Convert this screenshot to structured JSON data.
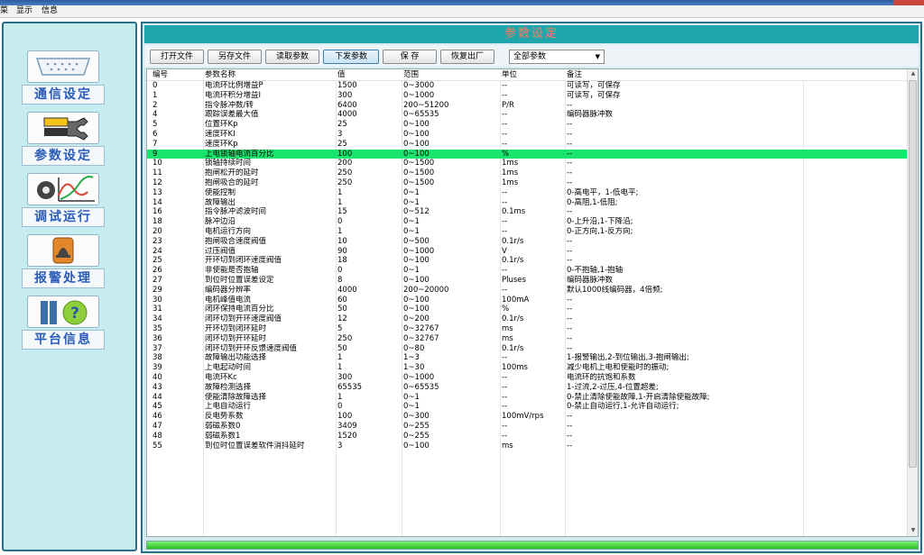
{
  "menubar": {
    "items": [
      "菜",
      "显示",
      "信息"
    ]
  },
  "sidebar": {
    "items": [
      {
        "label": "通信设定",
        "icon": "serial-port-icon"
      },
      {
        "label": "参数设定",
        "icon": "tools-icon"
      },
      {
        "label": "调试运行",
        "icon": "chart-curve-icon"
      },
      {
        "label": "报警处理",
        "icon": "alarm-bell-icon"
      },
      {
        "label": "平台信息",
        "icon": "help-icon"
      }
    ]
  },
  "main": {
    "title": "参数设定",
    "toolbar": {
      "open_file": "打开文件",
      "save_as": "另存文件",
      "read_params": "读取参数",
      "download_params": "下发参数",
      "save": "保 存",
      "restore_factory": "恢复出厂",
      "filter_selected": "全部参数"
    },
    "table": {
      "columns": [
        "编号",
        "参数名称",
        "值",
        "范围",
        "单位",
        "备注"
      ],
      "selected_index": 7,
      "rows": [
        [
          "0",
          "电流环比例增益P",
          "1500",
          "0~3000",
          "--",
          "可读写，可保存"
        ],
        [
          "1",
          "电流环积分增益I",
          "300",
          "0~1000",
          "--",
          "可读写，可保存"
        ],
        [
          "2",
          "指令脉冲数/转",
          "6400",
          "200~51200",
          "P/R",
          "--"
        ],
        [
          "4",
          "跟踪误差最大值",
          "4000",
          "0~65535",
          "--",
          "编码器脉冲数"
        ],
        [
          "5",
          "位置环Kp",
          "25",
          "0~100",
          "--",
          "--"
        ],
        [
          "6",
          "速度环KI",
          "3",
          "0~100",
          "--",
          "--"
        ],
        [
          "7",
          "速度环Kp",
          "25",
          "0~100",
          "--",
          "--"
        ],
        [
          "9",
          "上电锁轴电流百分比",
          "100",
          "0~100",
          "%",
          "--"
        ],
        [
          "10",
          "锁轴持续时间",
          "200",
          "0~1500",
          "1ms",
          "--"
        ],
        [
          "11",
          "抱闸松开的延时",
          "250",
          "0~1500",
          "1ms",
          "--"
        ],
        [
          "12",
          "抱闸吸合的延时",
          "250",
          "0~1500",
          "1ms",
          "--"
        ],
        [
          "13",
          "使能控制",
          "1",
          "0~1",
          "--",
          "0-高电平，1-低电平;"
        ],
        [
          "14",
          "故障输出",
          "1",
          "0~1",
          "--",
          "0-高阻,1-低阻;"
        ],
        [
          "16",
          "指令脉冲滤波时间",
          "15",
          "0~512",
          "0.1ms",
          "--"
        ],
        [
          "18",
          "脉冲边沿",
          "0",
          "0~1",
          "--",
          "0-上升沿,1-下降沿;"
        ],
        [
          "20",
          "电机运行方向",
          "1",
          "0~1",
          "--",
          "0-正方向,1-反方向;"
        ],
        [
          "23",
          "抱闸吸合速度阀值",
          "10",
          "0~500",
          "0.1r/s",
          "--"
        ],
        [
          "24",
          "过压阀值",
          "90",
          "0~1000",
          "V",
          "--"
        ],
        [
          "25",
          "开环切到闭环速度阀值",
          "18",
          "0~100",
          "0.1r/s",
          "--"
        ],
        [
          "26",
          "非使能是否抱轴",
          "0",
          "0~1",
          "--",
          "0-不抱轴,1-抱轴"
        ],
        [
          "27",
          "到位时位置误差设定",
          "8",
          "0~100",
          "Pluses",
          "编码器脉冲数"
        ],
        [
          "29",
          "编码器分辨率",
          "4000",
          "200~20000",
          "--",
          "默认1000线编码器，4倍频;"
        ],
        [
          "30",
          "电机峰值电流",
          "60",
          "0~100",
          "100mA",
          "--"
        ],
        [
          "31",
          "闭环保持电流百分比",
          "50",
          "0~100",
          "%",
          "--"
        ],
        [
          "34",
          "闭环切到开环速度阀值",
          "12",
          "0~200",
          "0.1r/s",
          "--"
        ],
        [
          "35",
          "开环切到闭环延时",
          "5",
          "0~32767",
          "ms",
          "--"
        ],
        [
          "36",
          "闭环切到开环延时",
          "250",
          "0~32767",
          "ms",
          "--"
        ],
        [
          "37",
          "闭环切到开环反馈速度阀值",
          "50",
          "0~80",
          "0.1r/s",
          "--"
        ],
        [
          "38",
          "故障输出功能选择",
          "1",
          "1~3",
          "--",
          "1-报警输出,2-到位输出,3-抱闸输出;"
        ],
        [
          "39",
          "上电起动时间",
          "1",
          "1~30",
          "100ms",
          "减少电机上电和使能时的振动;"
        ],
        [
          "40",
          "电流环Kc",
          "300",
          "0~1000",
          "--",
          "电流环的抗饱和系数"
        ],
        [
          "43",
          "故障检测选择",
          "65535",
          "0~65535",
          "--",
          "1-过流,2-过压,4-位置超差;"
        ],
        [
          "44",
          "使能清除故障选择",
          "1",
          "0~1",
          "--",
          "0-禁止清除使能故障,1-开启清除使能故障;"
        ],
        [
          "45",
          "上电自动运行",
          "0",
          "0~1",
          "--",
          "0-禁止自动运行,1-允许自动运行;"
        ],
        [
          "46",
          "反电势系数",
          "100",
          "0~300",
          "100mV/rps",
          "--"
        ],
        [
          "47",
          "弱磁系数0",
          "3409",
          "0~255",
          "--",
          "--"
        ],
        [
          "48",
          "弱磁系数1",
          "1520",
          "0~255",
          "--",
          "--"
        ],
        [
          "55",
          "到位时位置误差软件消抖延时",
          "3",
          "0~100",
          "ms",
          "--"
        ]
      ]
    },
    "progress": 1.0
  }
}
